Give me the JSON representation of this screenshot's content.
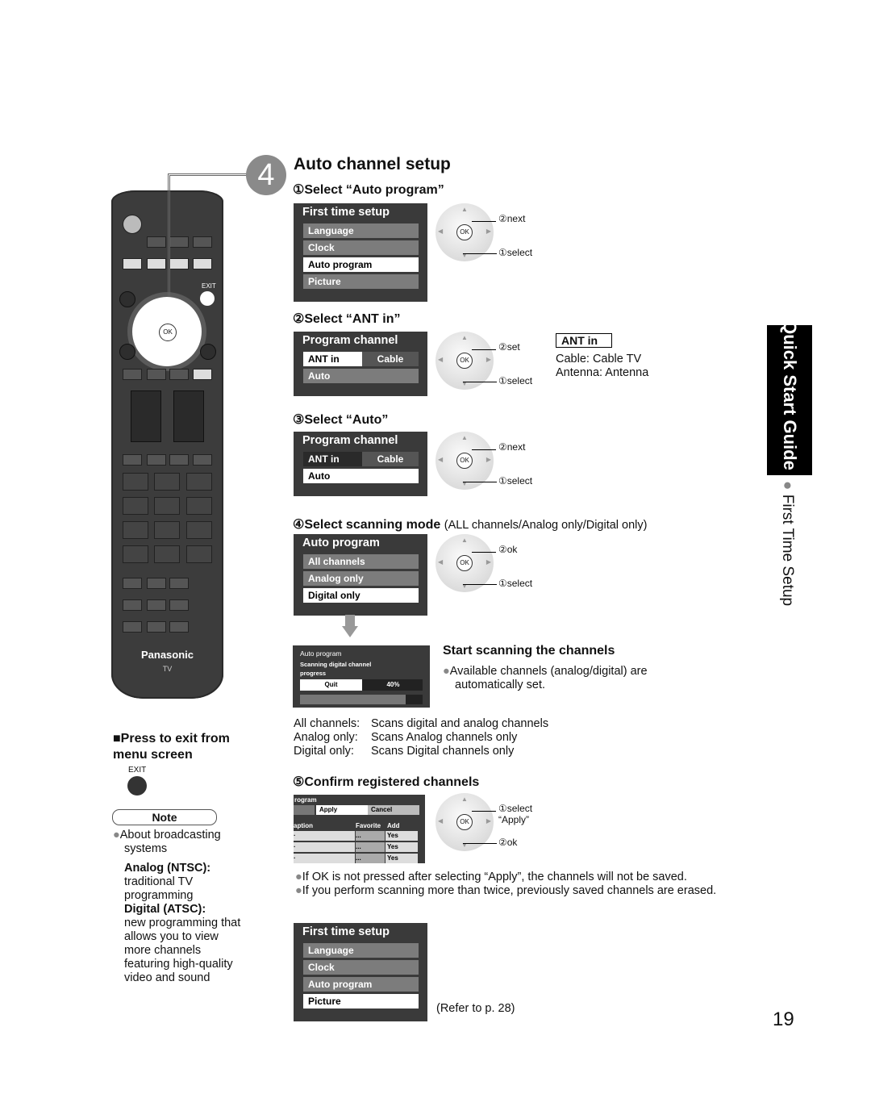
{
  "step": {
    "number": "4",
    "title": "Auto channel setup"
  },
  "substeps": [
    {
      "label": "①Select “Auto program”"
    },
    {
      "label": "②Select “ANT in”"
    },
    {
      "label": "③Select “Auto”"
    },
    {
      "label": "④Select scanning mode",
      "note": "(ALL channels/Analog only/Digital only)"
    },
    {
      "label": "⑤Confirm registered channels"
    }
  ],
  "menus": [
    {
      "title": "First time setup",
      "items": [
        {
          "label": "Language"
        },
        {
          "label": "Clock"
        },
        {
          "label": "Auto program",
          "selected": true
        },
        {
          "label": "Picture"
        }
      ]
    },
    {
      "title": "Program channel",
      "items": [
        {
          "label": "ANT in",
          "value": "Cable",
          "selected": true
        },
        {
          "label": "Auto"
        }
      ]
    },
    {
      "title": "Program channel",
      "items": [
        {
          "label": "ANT in",
          "value": "Cable",
          "plain": true
        },
        {
          "label": "Auto",
          "selected": true
        }
      ]
    },
    {
      "title": "Auto program",
      "items": [
        {
          "label": "All channels"
        },
        {
          "label": "Analog only"
        },
        {
          "label": "Digital only",
          "selected": true
        }
      ]
    },
    {
      "title": "First time setup",
      "items": [
        {
          "label": "Language"
        },
        {
          "label": "Clock"
        },
        {
          "label": "Auto program"
        },
        {
          "label": "Picture",
          "selected": true
        }
      ]
    }
  ],
  "dials": [
    {
      "top": "②next",
      "bottom": "①select"
    },
    {
      "top": "②set",
      "bottom": "①select"
    },
    {
      "top": "②next",
      "bottom": "①select"
    },
    {
      "top": "②ok",
      "bottom": "①select"
    },
    {
      "top": "①select “Apply”",
      "bottom": "②ok"
    }
  ],
  "ok_label": "OK",
  "ant_in": {
    "badge": "ANT in",
    "cable": "Cable:  Cable TV",
    "antenna": "Antenna:  Antenna"
  },
  "progress": {
    "title": "Auto program",
    "subtitle": "Scanning digital channel progress",
    "quit": "Quit",
    "percent_label": "40%",
    "percent": 40
  },
  "scan": {
    "heading": "Start scanning the channels",
    "bullet": "Available channels (analog/digital) are automatically set."
  },
  "modes": [
    {
      "k": "All channels:",
      "v": "Scans digital and analog channels"
    },
    {
      "k": "Analog only:",
      "v": "Scans Analog channels only"
    },
    {
      "k": "Digital only:",
      "v": "Scans Digital channels only"
    }
  ],
  "confirm": {
    "title": "rogram",
    "apply": "Apply",
    "cancel": "Cancel",
    "cols": [
      "aption",
      "Favorite",
      "Add"
    ],
    "rows": [
      {
        "fav": "...",
        "add": "Yes"
      },
      {
        "fav": "...",
        "add": "Yes"
      },
      {
        "fav": "...",
        "add": "Yes"
      }
    ]
  },
  "notes": [
    "If OK is not pressed after selecting “Apply”, the channels will not be saved.",
    "If you perform scanning more than twice, previously saved channels are erased."
  ],
  "refer": "(Refer to p. 28)",
  "remote": {
    "brand": "Panasonic",
    "model": "TV",
    "exit": "EXIT",
    "ok": "OK"
  },
  "left": {
    "press_exit": "Press to exit from menu screen",
    "exit_label": "EXIT",
    "note_title": "Note",
    "about": "About broadcasting systems",
    "analog_h": "Analog (NTSC):",
    "analog_t": "traditional TV programming",
    "digital_h": "Digital (ATSC):",
    "digital_t": "new programming that allows you to view more channels featuring high-quality video and sound"
  },
  "sidebar": {
    "tab": "Quick Start Guide",
    "section": "First Time Setup"
  },
  "page_number": "19"
}
